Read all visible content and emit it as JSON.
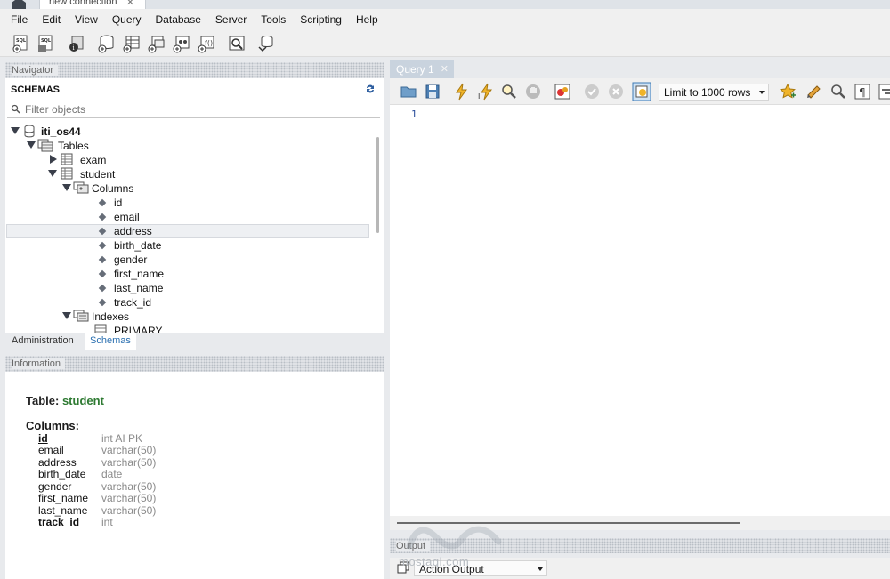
{
  "tabstrip": {
    "connection_tab": "new connection",
    "close_glyph": "✕"
  },
  "menu": [
    "File",
    "Edit",
    "View",
    "Query",
    "Database",
    "Server",
    "Tools",
    "Scripting",
    "Help"
  ],
  "main_toolbar_icons": [
    "new-sql-tab-icon",
    "open-sql-script-icon",
    "inspector-icon",
    "create-schema-icon",
    "create-table-icon",
    "create-view-icon",
    "create-procedure-icon",
    "create-function-icon",
    "search-table-data-icon",
    "reconnect-icon"
  ],
  "navigator": {
    "header": "Navigator",
    "schemas_title": "SCHEMAS",
    "filter_placeholder": "Filter objects",
    "tree": {
      "schema": "iti_os44",
      "tables_label": "Tables",
      "table_exam": "exam",
      "table_student": "student",
      "columns_label": "Columns",
      "columns": [
        "id",
        "email",
        "address",
        "birth_date",
        "gender",
        "first_name",
        "last_name",
        "track_id"
      ],
      "indexes_label": "Indexes",
      "index_primary": "PRIMARY"
    },
    "tabs": {
      "administration": "Administration",
      "schemas": "Schemas"
    }
  },
  "information": {
    "header": "Information",
    "table_prefix": "Table:",
    "table_name": "student",
    "columns_title": "Columns:",
    "columns": [
      {
        "name": "id",
        "type": "int AI PK"
      },
      {
        "name": "email",
        "type": "varchar(50)"
      },
      {
        "name": "address",
        "type": "varchar(50)"
      },
      {
        "name": "birth_date",
        "type": "date"
      },
      {
        "name": "gender",
        "type": "varchar(50)"
      },
      {
        "name": "first_name",
        "type": "varchar(50)"
      },
      {
        "name": "last_name",
        "type": "varchar(50)"
      },
      {
        "name": "track_id",
        "type": "int"
      }
    ]
  },
  "query": {
    "tab_label": "Query 1",
    "close_glyph": "✕",
    "limit_label": "Limit to 1000 rows",
    "line_number": "1"
  },
  "output": {
    "header": "Output",
    "selected": "Action Output",
    "watermark": "mostaql.com"
  },
  "colors": {
    "accent": "#2a6fb0",
    "table_name_green": "#2e7a32",
    "query_tab_bg": "#c9d3de"
  }
}
